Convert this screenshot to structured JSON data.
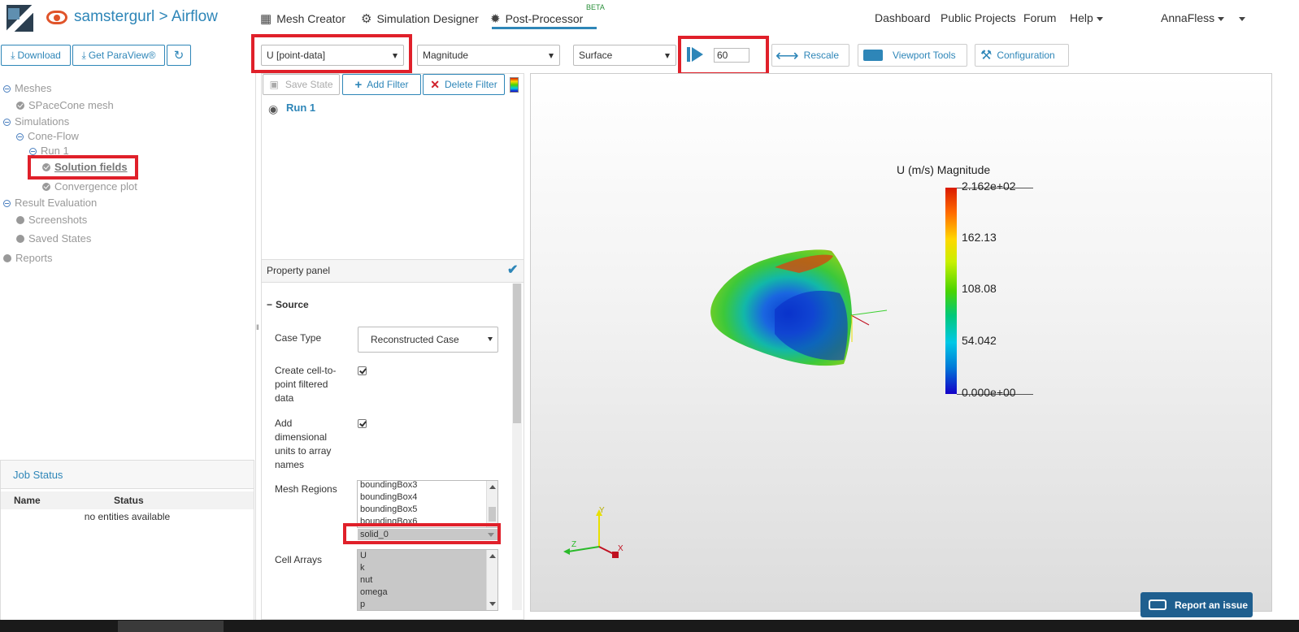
{
  "nav": {
    "brand": "samstergurl > Airflow",
    "links": {
      "mesh_creator": "Mesh Creator",
      "simulation_designer": "Simulation Designer",
      "post_processor": "Post-Processor",
      "beta": "BETA",
      "dashboard": "Dashboard",
      "public_projects": "Public Projects",
      "forum": "Forum",
      "help": "Help",
      "user": "AnnaFless"
    }
  },
  "toolbar": {
    "download": "Download",
    "get_paraview": "Get ParaView®",
    "field_select": "U [point-data]",
    "component_select": "Magnitude",
    "representation_select": "Surface",
    "time_value": "60",
    "rescale": "Rescale",
    "viewport_tools": "Viewport Tools",
    "configuration": "Configuration"
  },
  "tree": {
    "meshes": "Meshes",
    "spacecone_mesh": "SPaceCone mesh",
    "simulations": "Simulations",
    "cone_flow": "Cone-Flow",
    "run1": "Run 1",
    "solution_fields": "Solution fields",
    "convergence_plot": "Convergence plot",
    "result_evaluation": "Result Evaluation",
    "screenshots": "Screenshots",
    "saved_states": "Saved States",
    "reports": "Reports"
  },
  "job_status": {
    "title": "Job Status",
    "col_name": "Name",
    "col_status": "Status",
    "empty": "no entities available"
  },
  "pipeline": {
    "save_state": "Save State",
    "add_filter": "Add Filter",
    "delete_filter": "Delete Filter",
    "run_label": "Run 1"
  },
  "property_panel": {
    "title": "Property panel",
    "section": "Source",
    "case_type_label": "Case Type",
    "case_type_value": "Reconstructed Case",
    "create_cell_to_point_label": "Create cell-to-point filtered data",
    "add_units_label": "Add dimensional units to array names",
    "mesh_regions_label": "Mesh Regions",
    "mesh_regions": [
      "boundingBox3",
      "boundingBox4",
      "boundingBox5",
      "boundingBox6"
    ],
    "mesh_region_selected": "solid_0",
    "cell_arrays_label": "Cell Arrays",
    "cell_arrays": [
      "U",
      "k",
      "nut",
      "omega",
      "p"
    ]
  },
  "viewport": {
    "colorbar_title": "U (m/s) Magnitude",
    "colorbar_labels": [
      "2.162e+02",
      "162.13",
      "108.08",
      "54.042",
      "0.000e+00"
    ],
    "axis_y": "Y",
    "axis_z": "Z",
    "axis_x": "X"
  },
  "report_issue": "Report an issue"
}
